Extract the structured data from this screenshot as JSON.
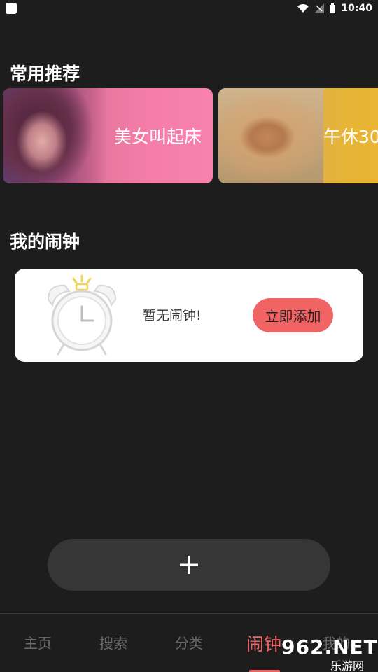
{
  "status_bar": {
    "time": "10:40"
  },
  "recommend": {
    "title": "常用推荐",
    "cards": [
      {
        "label": "美女叫起床"
      },
      {
        "label": "午休30"
      }
    ]
  },
  "my_alarm": {
    "title": "我的闹钟",
    "empty_text": "暂无闹钟!",
    "add_now_label": "立即添加"
  },
  "add_button": {
    "icon": "plus-icon"
  },
  "bottom_nav": {
    "items": [
      {
        "label": "主页"
      },
      {
        "label": "搜索"
      },
      {
        "label": "分类"
      },
      {
        "label": "闹钟",
        "active": true
      },
      {
        "label": "我的"
      }
    ]
  },
  "watermark": {
    "number": "962.NET",
    "sub": "乐游网"
  },
  "colors": {
    "background": "#1e1d1e",
    "accent": "#f06464",
    "card_bg": "#ffffff",
    "plus_bg": "#363636"
  }
}
